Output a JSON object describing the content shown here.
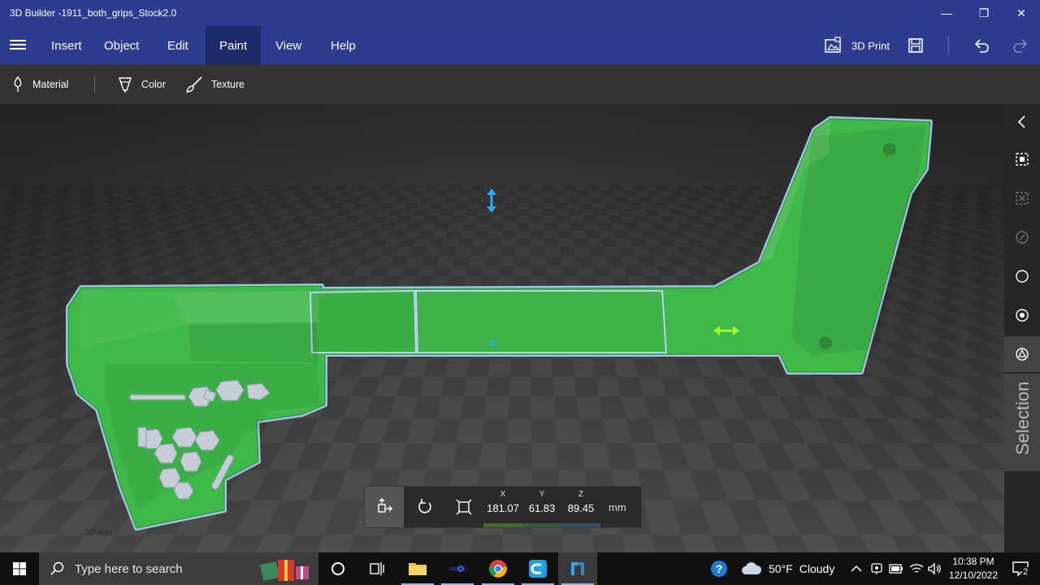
{
  "window": {
    "title": "3D Builder -1911_both_grips_Stock2.0",
    "minimize_glyph": "—",
    "restore_glyph": "❐",
    "close_glyph": "✕"
  },
  "menubar": {
    "items": [
      {
        "label": "Insert"
      },
      {
        "label": "Object"
      },
      {
        "label": "Edit"
      },
      {
        "label": "Paint",
        "active": true
      },
      {
        "label": "View"
      },
      {
        "label": "Help"
      }
    ],
    "print_label": "3D Print"
  },
  "toolbar": {
    "material_label": "Material",
    "color_label": "Color",
    "texture_label": "Texture"
  },
  "viewport": {
    "model_color": "#3fb84a",
    "outline_color": "#9fc4e6",
    "floor_scale_label": "50 mm"
  },
  "side_panel": {
    "selection_label": "Selection"
  },
  "dimensions": {
    "x_label": "X",
    "x_value": "181.07",
    "x_color": "#4a6b2f",
    "y_label": "Y",
    "y_value": "61.83",
    "y_color": "#3a5a3a",
    "z_label": "Z",
    "z_value": "89.45",
    "z_color": "#3a4e6a",
    "unit": "mm"
  },
  "taskbar": {
    "search_placeholder": "Type here to search",
    "weather_temp": "50°F",
    "weather_text": "Cloudy",
    "time": "10:38 PM",
    "date": "12/10/2022",
    "notification_count": "2"
  }
}
